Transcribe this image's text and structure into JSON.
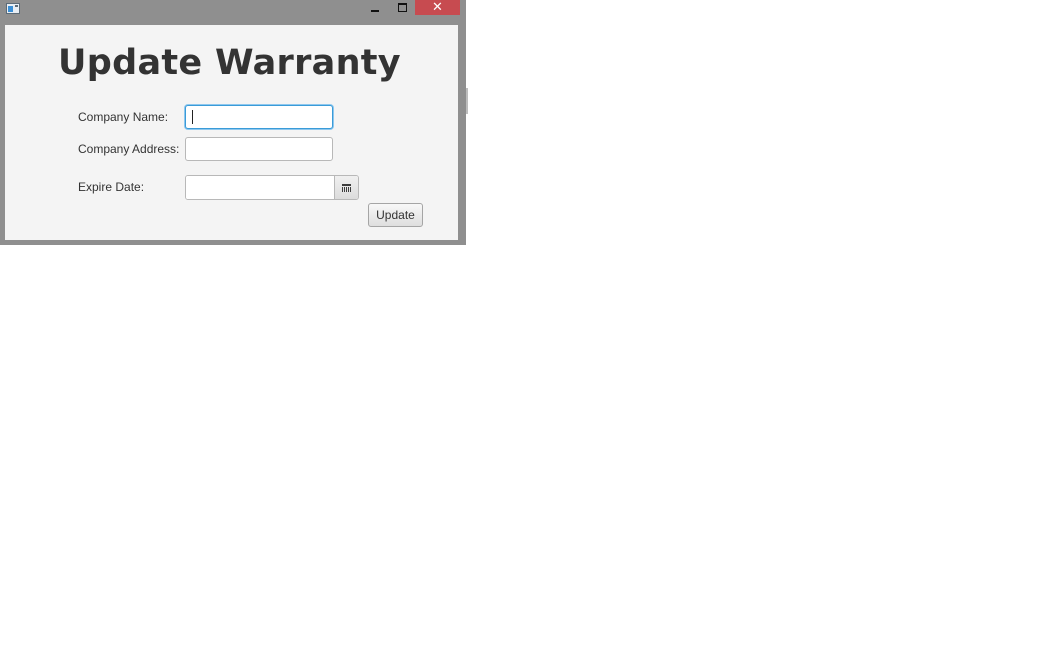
{
  "window": {
    "close_glyph": "✕",
    "colors": {
      "close_button": "#c74b50",
      "frame": "#8f8f8f",
      "content_bg": "#f4f4f4"
    }
  },
  "form": {
    "title": "Update Warranty",
    "company_name": {
      "label": "Company Name:",
      "value": ""
    },
    "company_address": {
      "label": "Company Address:",
      "value": ""
    },
    "expire_date": {
      "label": "Expire Date:",
      "value": "",
      "icon": "calendar-icon"
    },
    "update_label": "Update"
  }
}
